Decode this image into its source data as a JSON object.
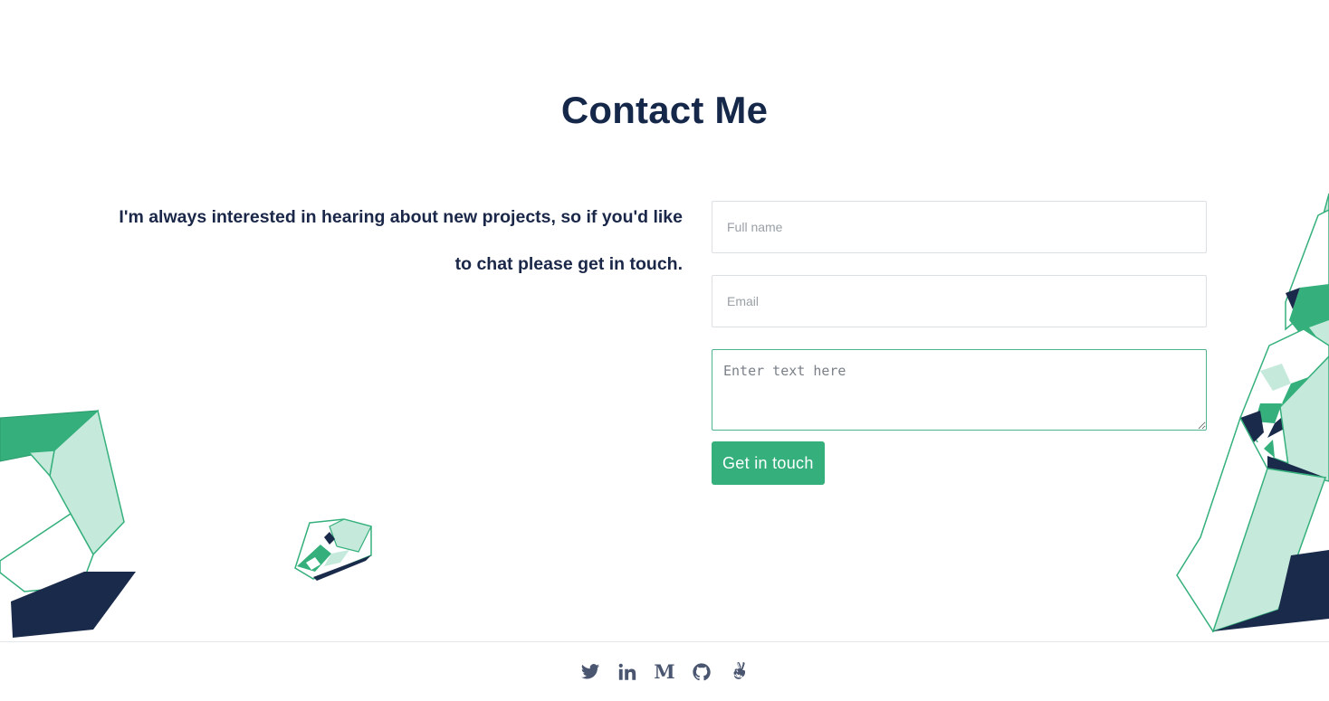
{
  "header": {
    "title": "Contact Me"
  },
  "intro": {
    "text": "I'm always interested in hearing about new projects, so if you'd like to chat please get in touch."
  },
  "form": {
    "name_placeholder": "Full name",
    "email_placeholder": "Email",
    "message_placeholder": "Enter text here",
    "submit_label": "Get in touch"
  },
  "footer": {
    "social": [
      {
        "icon": "twitter-icon"
      },
      {
        "icon": "linkedin-icon"
      },
      {
        "icon": "medium-icon",
        "glyph": "M"
      },
      {
        "icon": "github-icon"
      },
      {
        "icon": "angellist-icon"
      }
    ]
  },
  "colors": {
    "heading": "#152849",
    "accent_green": "#35b07c",
    "light_green": "#c5eadb",
    "navy": "#1a2a4a",
    "footer_icon": "#4a5570"
  }
}
